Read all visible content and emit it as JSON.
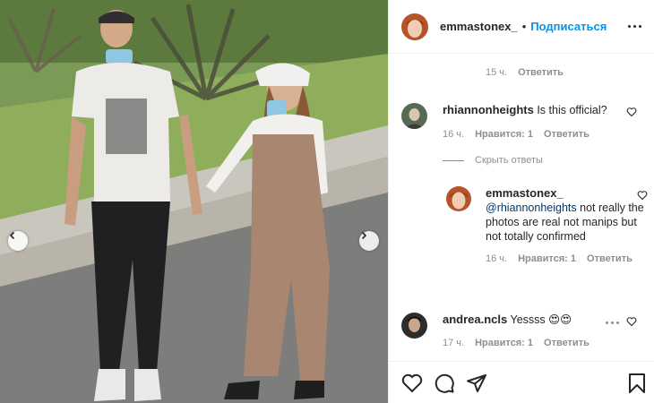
{
  "post": {
    "username": "emmastonex_",
    "follow_label": "Подписаться",
    "separator": "•"
  },
  "caption_meta": {
    "time": "15 ч.",
    "reply_label": "Ответить"
  },
  "comments": [
    {
      "username": "rhiannonheights",
      "text": "Is this official?",
      "time": "16 ч.",
      "likes": "Нравится: 1",
      "reply_label": "Ответить"
    },
    {
      "username": "andrea.ncls",
      "text": "Yessss 😍😍",
      "time": "17 ч.",
      "likes": "Нравится: 1",
      "reply_label": "Ответить"
    }
  ],
  "hide_replies_label": "Скрыть ответы",
  "reply": {
    "username": "emmastonex_",
    "mention": "@rhiannonheights",
    "text": " not really the photos are real not manips but not totally confirmed",
    "time": "16 ч.",
    "likes": "Нравится: 1",
    "reply_label": "Ответить"
  },
  "icons": [
    "chevron-left-icon",
    "chevron-right-icon",
    "more-icon",
    "heart-icon",
    "comment-icon",
    "share-icon",
    "bookmark-icon"
  ],
  "colors": {
    "link": "#0095f6",
    "mention": "#00376b",
    "muted": "#8e8e8e",
    "text": "#262626"
  }
}
